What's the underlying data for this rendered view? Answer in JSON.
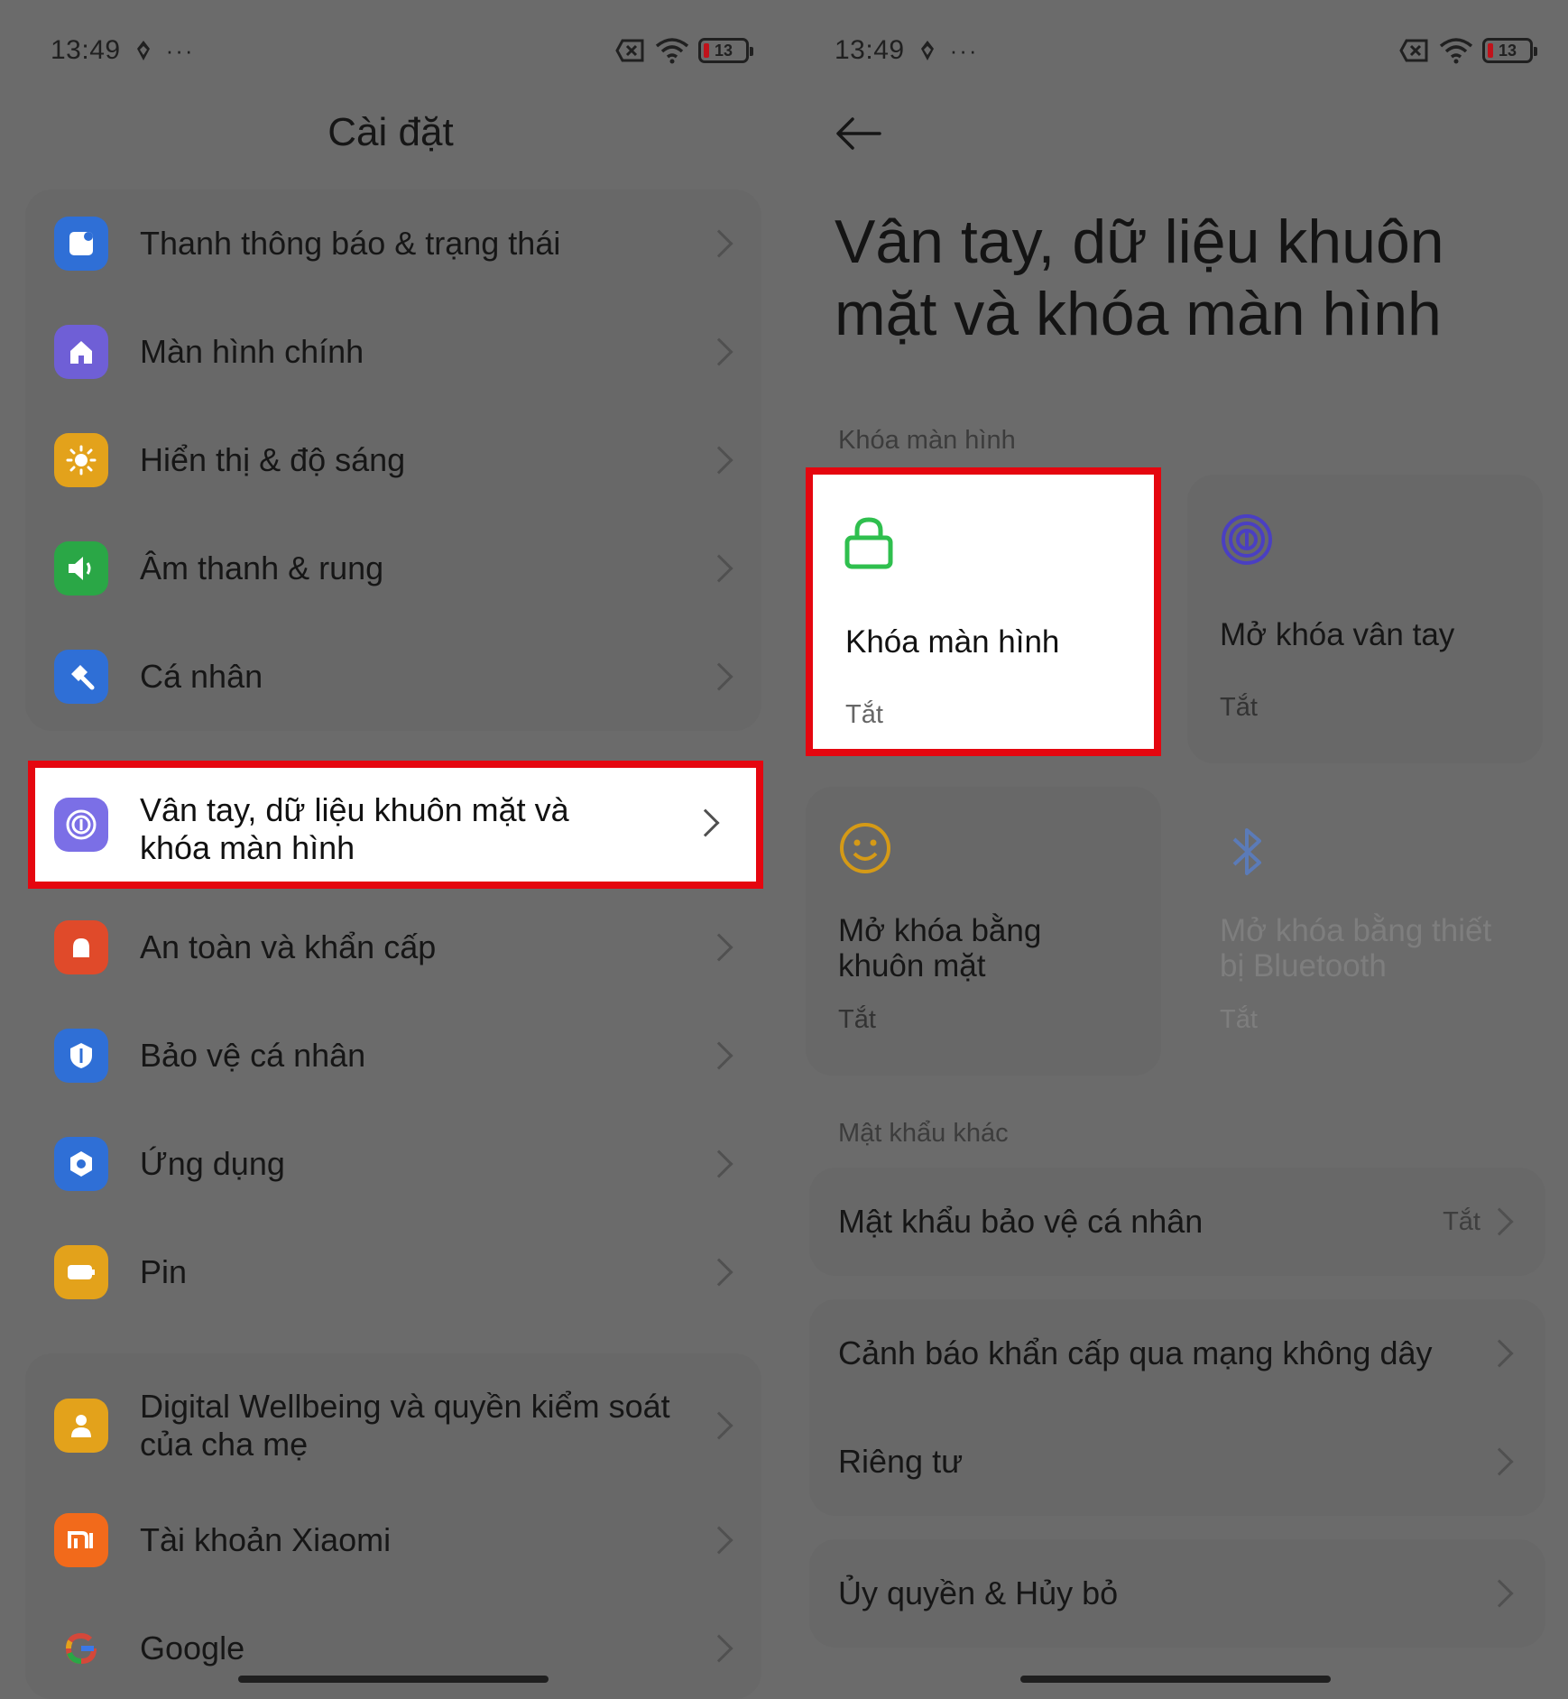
{
  "status": {
    "time": "13:49",
    "dots": "···",
    "battery": "13"
  },
  "left": {
    "title": "Cài đặt",
    "group1": [
      {
        "label": "Thanh thông báo & trạng thái",
        "icon": "notification-bar-icon",
        "color": "#2f6fd6"
      },
      {
        "label": "Màn hình chính",
        "icon": "home-icon",
        "color": "#6f5fd6"
      },
      {
        "label": "Hiển thị & độ sáng",
        "icon": "sun-icon",
        "color": "#e3a21b"
      },
      {
        "label": "Âm thanh & rung",
        "icon": "speaker-icon",
        "color": "#2aa746"
      },
      {
        "label": "Cá nhân",
        "icon": "brush-icon",
        "color": "#2f6fd6"
      }
    ],
    "highlighted": {
      "label": "Vân tay, dữ liệu khuôn mặt và khóa màn hình",
      "icon": "fingerprint-icon",
      "color": "#7b6fe6"
    },
    "group2": [
      {
        "label": "An toàn và khẩn cấp",
        "icon": "emergency-icon",
        "color": "#e04a2a"
      },
      {
        "label": "Bảo vệ cá nhân",
        "icon": "privacy-shield-icon",
        "color": "#2f6fd6"
      },
      {
        "label": "Ứng dụng",
        "icon": "apps-icon",
        "color": "#2f6fd6"
      },
      {
        "label": "Pin",
        "icon": "battery-icon",
        "color": "#e3a21b"
      }
    ],
    "group3": [
      {
        "label": "Digital Wellbeing và quyền kiểm soát của cha mẹ",
        "icon": "wellbeing-icon",
        "color": "#e3a21b"
      },
      {
        "label": "Tài khoản Xiaomi",
        "icon": "xiaomi-icon",
        "color": "#f26a1b"
      },
      {
        "label": "Google",
        "icon": "google-icon",
        "color": "#ffffff"
      }
    ]
  },
  "right": {
    "title": "Vân tay, dữ liệu khuôn mặt và khóa màn hình",
    "section_lock": "Khóa màn hình",
    "tiles": [
      {
        "title": "Khóa màn hình",
        "sub": "Tắt",
        "icon": "lock-icon",
        "color": "#2fbf4e"
      },
      {
        "title": "Mở khóa vân tay",
        "sub": "Tắt",
        "icon": "fingerprint-icon",
        "color": "#4a3fc2"
      },
      {
        "title": "Mở khóa bằng khuôn mặt",
        "sub": "Tắt",
        "icon": "face-icon",
        "color": "#d59a16"
      },
      {
        "title": "Mở khóa bằng thiết bị Bluetooth",
        "sub": "Tắt",
        "icon": "bluetooth-icon",
        "color": "#5b7bb8"
      }
    ],
    "section_other": "Mật khẩu khác",
    "privacy_password": {
      "label": "Mật khẩu bảo vệ cá nhân",
      "value": "Tắt"
    },
    "list2": [
      "Cảnh báo khẩn cấp qua mạng không dây",
      "Riêng tư"
    ],
    "list3": [
      "Ủy quyền & Hủy bỏ"
    ]
  }
}
